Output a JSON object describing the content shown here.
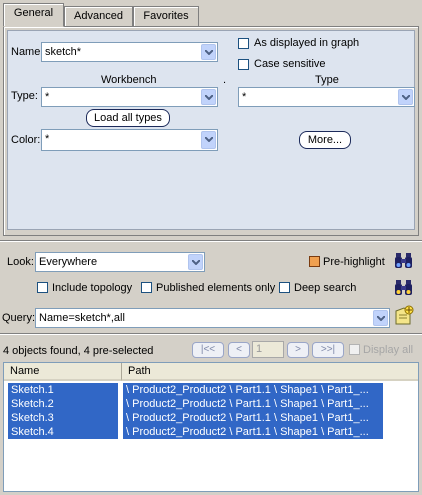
{
  "tabs": [
    {
      "label": "General",
      "active": true
    },
    {
      "label": "Advanced",
      "active": false
    },
    {
      "label": "Favorites",
      "active": false
    }
  ],
  "general": {
    "name_label": "Name:",
    "name_value": "sketch*",
    "as_displayed_label": "As displayed in graph",
    "as_displayed_checked": false,
    "case_sensitive_label": "Case sensitive",
    "case_sensitive_checked": false,
    "workbench_header": "Workbench",
    "dot": ".",
    "type_header": "Type",
    "type_label": "Type:",
    "workbench_value": "*",
    "type_value": "*",
    "load_all_types_label": "Load all types",
    "color_label": "Color:",
    "color_value": "*",
    "more_label": "More..."
  },
  "search": {
    "look_label": "Look:",
    "look_value": "Everywhere",
    "prehighlight_label": "Pre-highlight",
    "prehighlight_checked": true,
    "include_topology_label": "Include topology",
    "published_only_label": "Published elements only",
    "deep_search_label": "Deep search",
    "query_label": "Query:",
    "query_value": "Name=sketch*,all"
  },
  "results": {
    "status": "4 objects found, 4 pre-selected",
    "nav_first": "|<<",
    "nav_prev": "<",
    "page_value": "1",
    "nav_next": ">",
    "nav_last": ">>|",
    "display_all_label": "Display all",
    "columns": [
      "Name",
      "Path"
    ],
    "rows": [
      {
        "name": "Sketch.1",
        "path": "\\ Product2_Product2 \\ Part1.1 \\ Shape1 \\ Part1_..."
      },
      {
        "name": "Sketch.2",
        "path": "\\ Product2_Product2 \\ Part1.1 \\ Shape1 \\ Part1_..."
      },
      {
        "name": "Sketch.3",
        "path": "\\ Product2_Product2 \\ Part1.1 \\ Shape1 \\ Part1_..."
      },
      {
        "name": "Sketch.4",
        "path": "\\ Product2_Product2 \\ Part1.1 \\ Shape1 \\ Part1_..."
      }
    ]
  },
  "icons": {
    "search": "binoculars-icon",
    "select": "binoculars-select-icon",
    "favorite": "add-favorite-icon"
  },
  "colors": {
    "selection": "#3167c6",
    "panel": "#dde4ef",
    "window": "#d4d0c8",
    "prehighlight": "#f0a050"
  }
}
